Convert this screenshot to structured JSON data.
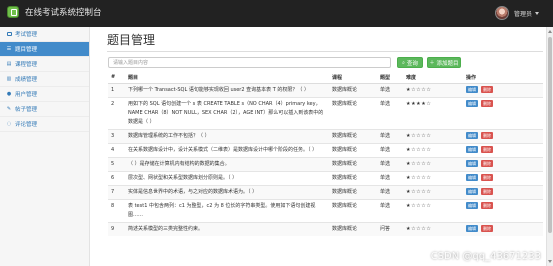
{
  "app": {
    "title": "在线考试系统控制台"
  },
  "user": {
    "name": "管理员"
  },
  "sidebar": {
    "items": [
      {
        "label": "考试管理",
        "icon": "monitor-icon"
      },
      {
        "label": "题目管理",
        "icon": "list-icon",
        "active": true
      },
      {
        "label": "课程管理",
        "icon": "book-icon"
      },
      {
        "label": "成绩管理",
        "icon": "chart-icon"
      },
      {
        "label": "用户管理",
        "icon": "user-icon"
      },
      {
        "label": "帖子管理",
        "icon": "pencil-icon"
      },
      {
        "label": "评论管理",
        "icon": "comment-icon"
      }
    ]
  },
  "main": {
    "title": "题目管理",
    "search": {
      "placeholder": "请输入题目内容",
      "value": ""
    },
    "search_button": "查询",
    "add_button": "添加题目",
    "table": {
      "headers": [
        "#",
        "题目",
        "课程",
        "题型",
        "难度",
        "操作"
      ],
      "edit_label": "编辑",
      "delete_label": "删除",
      "rows": [
        {
          "no": "1",
          "question": "下列哪一个 Transact-SQL 语句能够实现收回 user2 查询基本表 T 的权限？（ ）",
          "course": "数据库概论",
          "type": "单选",
          "stars": "★☆☆☆☆"
        },
        {
          "no": "2",
          "question": "用如下的 SQL 语句创建一个 s 表 CREATE TABLE s（NO CHAR（4）primary key，NAME CHAR（8）NOT NULL，SEX CHAR（2），AGE INT）那么可以插入到该表中的数据是（ ）",
          "course": "数据库概论",
          "type": "单选",
          "stars": "★★★★☆"
        },
        {
          "no": "3",
          "question": "数据库管理系统的工作不包括？（ ）",
          "course": "数据库概论",
          "type": "单选",
          "stars": "★☆☆☆☆"
        },
        {
          "no": "4",
          "question": "在关系数据库设计中，设计关系模式（二维表）是数据库设计中哪个阶段的任务。（ ）",
          "course": "数据库概论",
          "type": "单选",
          "stars": "★☆☆☆☆"
        },
        {
          "no": "5",
          "question": "（ ）是存储在计算机内有结构的数据的集合。",
          "course": "数据库概论",
          "type": "单选",
          "stars": "★☆☆☆☆"
        },
        {
          "no": "6",
          "question": "层次型、网状型和关系型数据库划分原则是。（ ）",
          "course": "数据库概论",
          "type": "单选",
          "stars": "★☆☆☆☆"
        },
        {
          "no": "7",
          "question": "实体是信息世界中的术语，与之对应的数据库术语为。（ ）",
          "course": "数据库概论",
          "type": "单选",
          "stars": "★☆☆☆☆"
        },
        {
          "no": "8",
          "question": "表 test1 中包含两列：c1 为整型，c2 为 8 位长的字符串类型。使用如下语句创建视图……",
          "course": "数据库概论",
          "type": "单选",
          "stars": "★☆☆☆☆"
        },
        {
          "no": "9",
          "question": "简述关系模型的三类完整性约束。",
          "course": "数据库概论",
          "type": "问答",
          "stars": "★☆☆☆☆"
        }
      ]
    }
  },
  "watermark": "CSDN @qq_43671233",
  "colors": {
    "topbar": "#222222",
    "accent": "#428bca",
    "success": "#5cb85c",
    "danger": "#d9534f"
  }
}
